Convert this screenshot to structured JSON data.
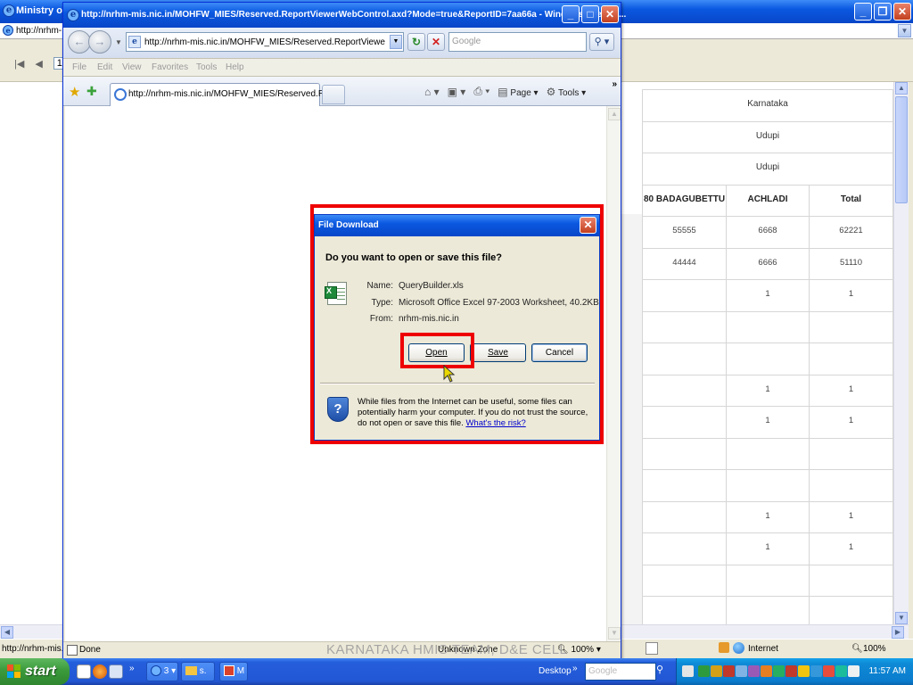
{
  "background_window": {
    "title": "Ministry of H",
    "address_text": "http://nrhm-",
    "pager_page": "1",
    "status_text": "http://nrhm-mis.",
    "status_zone": "Internet",
    "status_zoom": "100%"
  },
  "report_table": {
    "rows": [
      [
        "Karnataka"
      ],
      [
        "Udupi"
      ],
      [
        "Udupi"
      ],
      [
        "80 BADAGUBETTU",
        "ACHLADI",
        "Total"
      ],
      [
        "55555",
        "6668",
        "62221"
      ],
      [
        "44444",
        "6666",
        "51110"
      ],
      [
        "",
        "1",
        "1"
      ],
      [
        "",
        "",
        ""
      ],
      [
        "",
        "",
        ""
      ],
      [
        "",
        "1",
        "1"
      ],
      [
        "",
        "1",
        "1"
      ],
      [
        "",
        "",
        ""
      ],
      [
        "",
        "",
        ""
      ],
      [
        "",
        "1",
        "1"
      ],
      [
        "",
        "1",
        "1"
      ],
      [
        "",
        "",
        ""
      ],
      [
        "",
        "",
        ""
      ]
    ]
  },
  "popup_window": {
    "title": "http://nrhm-mis.nic.in/MOHFW_MIES/Reserved.ReportViewerWebControl.axd?Mode=true&ReportID=7aa66a - Windows Internet...",
    "url": "http://nrhm-mis.nic.in/MOHFW_MIES/Reserved.ReportViewerWebCo",
    "search_placeholder": "Google",
    "menu": [
      "File",
      "Edit",
      "View",
      "Favorites",
      "Tools",
      "Help"
    ],
    "tab_label": "http://nrhm-mis.nic.in/MOHFW_MIES/Reserved.Re...",
    "toolbar": {
      "page_label": "Page",
      "tools_label": "Tools",
      "more": "»"
    },
    "status_done": "Done",
    "status_zone": "Unknown Zone",
    "status_zoom": "100%"
  },
  "dialog": {
    "title": "File Download",
    "question": "Do you want to open or save this file?",
    "name_label": "Name:",
    "name_value": "QueryBuilder.xls",
    "type_label": "Type:",
    "type_value": "Microsoft Office Excel 97-2003 Worksheet, 40.2KB",
    "from_label": "From:",
    "from_value": "nrhm-mis.nic.in",
    "open_label": "Open",
    "save_label": "Save",
    "cancel_label": "Cancel",
    "warning_text": "While files from the Internet can be useful, some files can potentially harm your computer. If you do not trust the source, do not open or save this file.",
    "warning_link": "What's the risk?"
  },
  "watermark": "KARNATAKA HMIS TEAM, D&E CELL",
  "taskbar": {
    "start_label": "start",
    "ie_group_label": "3",
    "folder_label": "s.",
    "app_label": "M",
    "desktop_label": "Desktop",
    "search_placeholder": "Google",
    "clock": "11:57 AM"
  },
  "colors": {
    "xp_blue": "#0a58e0",
    "highlight_red": "#ee0000",
    "start_green": "#3b9a3b",
    "tray_blue": "#0b7ccd"
  }
}
